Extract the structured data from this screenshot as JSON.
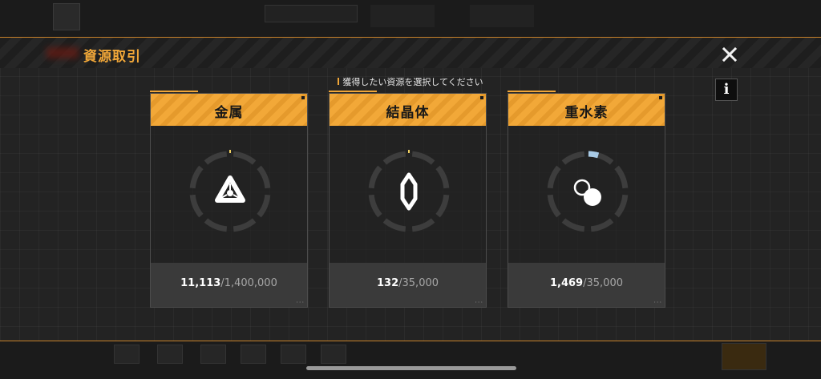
{
  "dialog": {
    "title": "資源取引",
    "instruction": "獲得したい資源を選択してください",
    "close_icon": "close-icon",
    "info_label": "i"
  },
  "resources": [
    {
      "name": "金属",
      "icon": "metal-triangle-icon",
      "current": "11,113",
      "max": "1,400,000",
      "separator": "/",
      "fill_fraction": 0.008
    },
    {
      "name": "結晶体",
      "icon": "crystal-hexagon-icon",
      "current": "132",
      "max": "35,000",
      "separator": "/",
      "fill_fraction": 0.004
    },
    {
      "name": "重水素",
      "icon": "deuterium-orbs-icon",
      "current": "1,469",
      "max": "35,000",
      "separator": "/",
      "fill_fraction": 0.042
    }
  ],
  "colors": {
    "accent": "#f0a638",
    "card_header": "#f2a838",
    "gauge_fill": "#a9cbe6"
  }
}
